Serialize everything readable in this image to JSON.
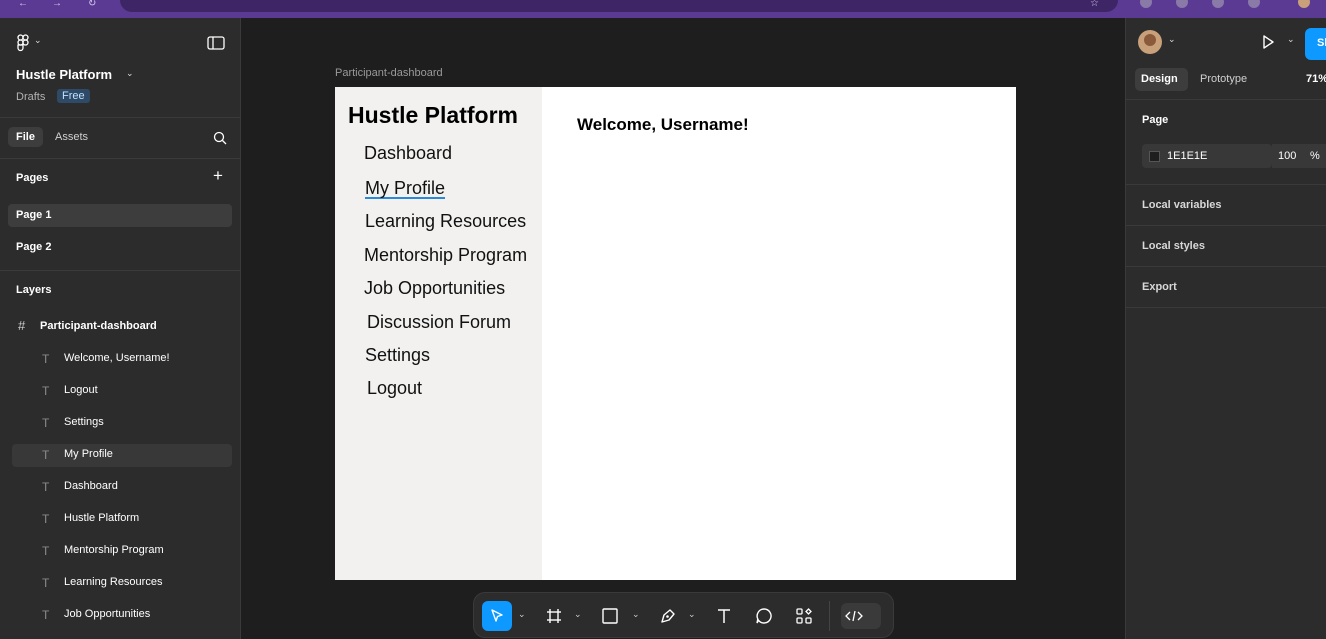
{
  "left_panel": {
    "file_name": "Hustle Platform",
    "drafts": "Drafts",
    "plan_badge": "Free",
    "tabs": {
      "file": "File",
      "assets": "Assets"
    },
    "pages_title": "Pages",
    "pages": [
      "Page 1",
      "Page 2"
    ],
    "layers_title": "Layers",
    "frame_layer": "Participant-dashboard",
    "layers": [
      "Welcome, Username!",
      "Logout",
      "Settings",
      "My Profile",
      "Dashboard",
      "Hustle Platform",
      "Mentorship Program",
      "Learning Resources",
      "Job Opportunities"
    ]
  },
  "canvas": {
    "frame_label": "Participant-dashboard",
    "frame_title": "Hustle Platform",
    "nav": [
      "Dashboard",
      "My Profile",
      "Learning Resources",
      "Mentorship Program",
      "Job Opportunities",
      "Discussion Forum",
      "Settings",
      "Logout"
    ],
    "welcome": "Welcome, Username!"
  },
  "right_panel": {
    "share_label": "Sh",
    "tabs": {
      "design": "Design",
      "prototype": "Prototype"
    },
    "zoom": "71%",
    "page_section": "Page",
    "page_color": "1E1E1E",
    "page_opacity": "100",
    "percent_sign": "%",
    "local_variables": "Local variables",
    "local_styles": "Local styles",
    "export": "Export"
  },
  "colors": {
    "accent": "#0d99ff",
    "canvas_bg": "#1e1e1e",
    "panel_bg": "#2c2c2c",
    "browser_bar": "#5b3a93"
  },
  "icons": [
    "figma-menu-icon",
    "panel-toggle-icon",
    "chevron-down-icon",
    "search-icon",
    "plus-icon",
    "frame-icon",
    "text-icon",
    "move-tool-icon",
    "frame-tool-icon",
    "rectangle-tool-icon",
    "pen-tool-icon",
    "text-tool-icon",
    "comment-tool-icon",
    "actions-icon",
    "dev-mode-icon",
    "play-icon"
  ]
}
